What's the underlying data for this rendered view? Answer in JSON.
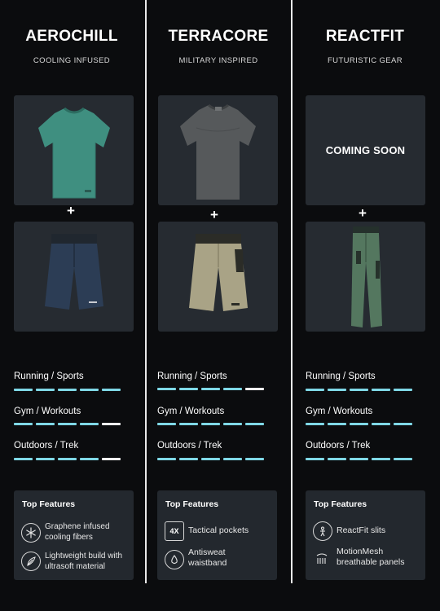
{
  "colors": {
    "background": "#0b0c0e",
    "card": "#262b31",
    "accent_cyan": "#7fd8e6",
    "bar_white": "#f2f2f2",
    "bar_dim": "#555b61"
  },
  "columns": [
    {
      "brand": "AEROCHILL",
      "tagline": "COOLING INFUSED",
      "top_image": "green-tshirt",
      "bottom_image": "navy-shorts",
      "plus": "+",
      "activities": [
        {
          "label": "Running / Sports",
          "segments": [
            "cyan",
            "cyan",
            "cyan",
            "cyan",
            "cyan"
          ]
        },
        {
          "label": "Gym / Workouts",
          "segments": [
            "cyan",
            "cyan",
            "cyan",
            "cyan",
            "white"
          ]
        },
        {
          "label": "Outdoors / Trek",
          "segments": [
            "cyan",
            "cyan",
            "cyan",
            "cyan",
            "white"
          ]
        }
      ],
      "features": {
        "title": "Top Features",
        "items": [
          {
            "icon": "snowflake-icon",
            "text": "Graphene infused cooling fibers"
          },
          {
            "icon": "feather-icon",
            "text": "Lightweight build with ultrasoft material"
          }
        ]
      }
    },
    {
      "brand": "TERRACORE",
      "tagline": "MILITARY INSPIRED",
      "top_image": "grey-tshirt",
      "bottom_image": "khaki-shorts",
      "plus": "+",
      "activities": [
        {
          "label": "Running / Sports",
          "segments": [
            "cyan",
            "cyan",
            "cyan",
            "cyan",
            "white"
          ]
        },
        {
          "label": "Gym / Workouts",
          "segments": [
            "cyan",
            "cyan",
            "cyan",
            "cyan",
            "cyan"
          ]
        },
        {
          "label": "Outdoors / Trek",
          "segments": [
            "cyan",
            "cyan",
            "cyan",
            "cyan",
            "cyan"
          ]
        }
      ],
      "features": {
        "title": "Top Features",
        "items": [
          {
            "icon": "pockets-4x-icon",
            "badge": "4X",
            "text": "Tactical pockets"
          },
          {
            "icon": "waistband-icon",
            "text": "Antisweat waistband"
          }
        ]
      }
    },
    {
      "brand": "REACTFIT",
      "tagline": "FUTURISTIC GEAR",
      "coming_soon": "COMING SOON",
      "bottom_image": "green-joggers",
      "plus": "+",
      "activities": [
        {
          "label": "Running / Sports",
          "segments": [
            "cyan",
            "cyan",
            "cyan",
            "cyan",
            "cyan"
          ]
        },
        {
          "label": "Gym / Workouts",
          "segments": [
            "cyan",
            "cyan",
            "cyan",
            "cyan",
            "cyan"
          ]
        },
        {
          "label": "Outdoors / Trek",
          "segments": [
            "cyan",
            "cyan",
            "cyan",
            "cyan",
            "cyan"
          ]
        }
      ],
      "features": {
        "title": "Top Features",
        "items": [
          {
            "icon": "slits-icon",
            "text": "ReactFit slits"
          },
          {
            "icon": "mesh-icon",
            "text": "MotionMesh breathable panels"
          }
        ]
      }
    }
  ]
}
